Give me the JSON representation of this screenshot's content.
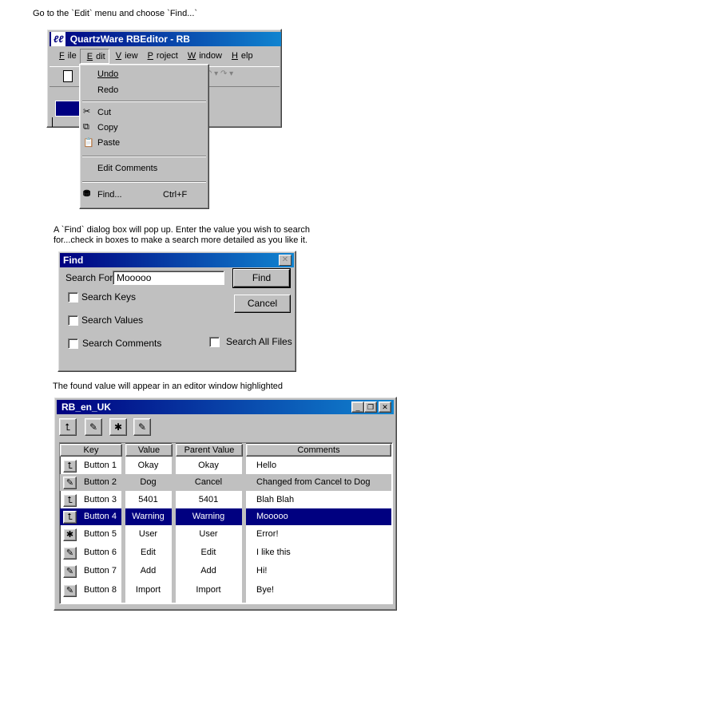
{
  "captions": {
    "step1": "Go to the `Edit` menu and choose `Find...`",
    "step2_line1": "A `Find` dialog box will pop up. Enter the value you wish to search",
    "step2_line2": "for...check in boxes to make a search more detailed as you like it.",
    "step3": "The found value will appear in an editor window highlighted"
  },
  "editor_window": {
    "logo": "ℓℓ",
    "title": "QuartzWare RBEditor -  RB",
    "menus": [
      "File",
      "Edit",
      "View",
      "Project",
      "Window",
      "Help"
    ],
    "edit_menu": {
      "items": [
        {
          "label": "Undo",
          "icon": ""
        },
        {
          "label": "Redo",
          "icon": ""
        },
        {
          "label": "Cut",
          "icon": "scissors-icon"
        },
        {
          "label": "Copy",
          "icon": "copy-icon"
        },
        {
          "label": "Paste",
          "icon": "paste-icon"
        },
        {
          "label": "Edit Comments",
          "icon": ""
        },
        {
          "label": "Find...",
          "icon": "binoculars-icon",
          "shortcut": "Ctrl+F"
        }
      ]
    }
  },
  "find_dialog": {
    "title": "Find",
    "search_for_label": "Search For:",
    "search_value": "Mooooo",
    "find_button": "Find",
    "cancel_button": "Cancel",
    "checkboxes": [
      "Search Keys",
      "Search Values",
      "Search Comments",
      "Search All Files"
    ]
  },
  "rb_window": {
    "title": "RB_en_UK",
    "columns": [
      "Key",
      "Value",
      "Parent Value",
      "Comments"
    ],
    "rows": [
      {
        "key": "Button 1",
        "value": "Okay",
        "parent": "Okay",
        "comment": "Hello",
        "state": "normal",
        "icon": "folder-up-icon"
      },
      {
        "key": "Button 2",
        "value": "Dog",
        "parent": "Cancel",
        "comment": "Changed from Cancel to Dog",
        "state": "gray",
        "icon": "edit-icon"
      },
      {
        "key": "Button 3",
        "value": "5401",
        "parent": "5401",
        "comment": "Blah Blah",
        "state": "normal",
        "icon": "folder-up-icon"
      },
      {
        "key": "Button 4",
        "value": "Warning",
        "parent": "Warning",
        "comment": "Mooooo",
        "state": "selected",
        "icon": "folder-up-icon"
      },
      {
        "key": "Button 5",
        "value": "User",
        "parent": "User",
        "comment": "Error!",
        "state": "normal",
        "icon": "folder-new-icon"
      },
      {
        "key": "Button 6",
        "value": "Edit",
        "parent": "Edit",
        "comment": "I like this",
        "state": "normal",
        "icon": "edit-icon"
      },
      {
        "key": "Button 7",
        "value": "Add",
        "parent": "Add",
        "comment": "Hi!",
        "state": "normal",
        "icon": "edit-icon"
      },
      {
        "key": "Button 8",
        "value": "Import",
        "parent": "Import",
        "comment": "Bye!",
        "state": "normal",
        "icon": "edit-icon"
      }
    ]
  },
  "colors": {
    "selection": "#000080",
    "changed_row": "#c0c0c0",
    "face": "#c0c0c0"
  }
}
